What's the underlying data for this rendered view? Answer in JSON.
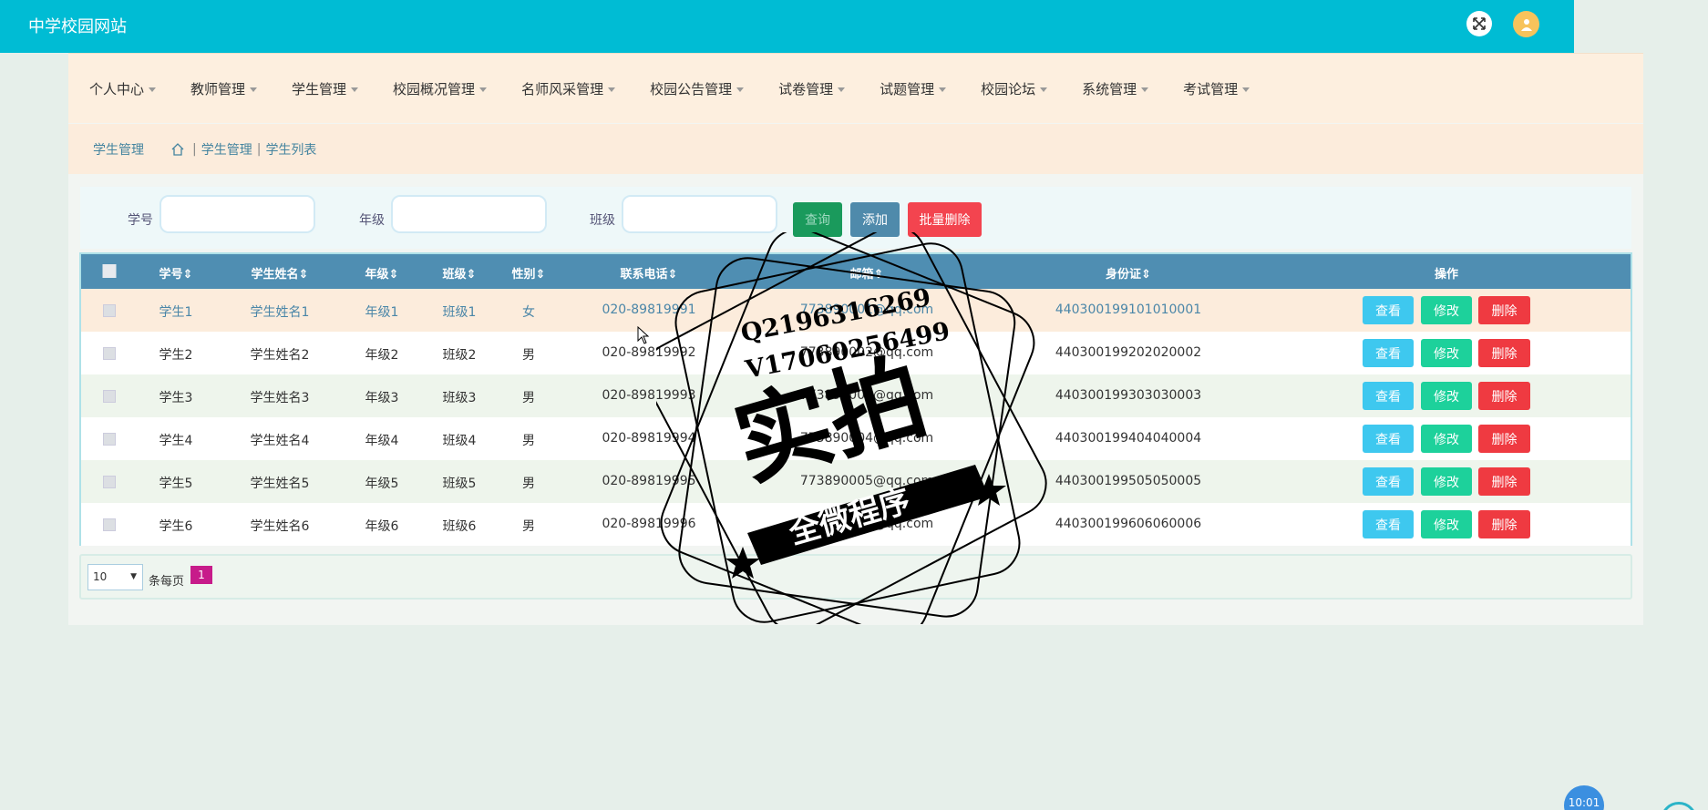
{
  "header": {
    "site_title": "中学校园网站"
  },
  "nav": {
    "items": [
      "个人中心",
      "教师管理",
      "学生管理",
      "校园概况管理",
      "名师风采管理",
      "校园公告管理",
      "试卷管理",
      "试题管理",
      "校园论坛",
      "系统管理",
      "考试管理"
    ]
  },
  "breadcrumb": {
    "title": "学生管理",
    "path1": "学生管理",
    "path2": "学生列表",
    "separator": "|"
  },
  "search": {
    "student_no_label": "学号",
    "grade_label": "年级",
    "class_label": "班级",
    "search_btn": "查询",
    "add_btn": "添加",
    "batch_delete_btn": "批量删除"
  },
  "table": {
    "headers": {
      "student_no": "学号",
      "name": "学生姓名",
      "grade": "年级",
      "class": "班级",
      "gender": "性别",
      "phone": "联系电话",
      "email": "邮箱",
      "id_card": "身份证",
      "ops": "操作"
    },
    "rows": [
      {
        "student_no": "学生1",
        "name": "学生姓名1",
        "grade": "年级1",
        "class": "班级1",
        "gender": "女",
        "phone": "020-89819991",
        "email": "773890001@qq.com",
        "id_card": "440300199101010001"
      },
      {
        "student_no": "学生2",
        "name": "学生姓名2",
        "grade": "年级2",
        "class": "班级2",
        "gender": "男",
        "phone": "020-89819992",
        "email": "773890002@qq.com",
        "id_card": "440300199202020002"
      },
      {
        "student_no": "学生3",
        "name": "学生姓名3",
        "grade": "年级3",
        "class": "班级3",
        "gender": "男",
        "phone": "020-89819993",
        "email": "773890003@qq.com",
        "id_card": "440300199303030003"
      },
      {
        "student_no": "学生4",
        "name": "学生姓名4",
        "grade": "年级4",
        "class": "班级4",
        "gender": "男",
        "phone": "020-89819994",
        "email": "773890004@qq.com",
        "id_card": "440300199404040004"
      },
      {
        "student_no": "学生5",
        "name": "学生姓名5",
        "grade": "年级5",
        "class": "班级5",
        "gender": "男",
        "phone": "020-89819995",
        "email": "773890005@qq.com",
        "id_card": "440300199505050005"
      },
      {
        "student_no": "学生6",
        "name": "学生姓名6",
        "grade": "年级6",
        "class": "班级6",
        "gender": "男",
        "phone": "020-89819996",
        "email": "773890006@qq.com",
        "id_card": "440300199606060006"
      }
    ],
    "actions": {
      "view": "查看",
      "edit": "修改",
      "delete": "删除"
    }
  },
  "pager": {
    "page_size": "10",
    "per_page_label": "条每页",
    "current_page": "1"
  },
  "clock": {
    "time": "10:01"
  },
  "stamp": {
    "line1": "Q2196316269",
    "line2": "V17060256499",
    "big": "实拍",
    "banner": "全微程序"
  },
  "colors": {
    "topbar": "#00bcd4",
    "navbar": "#fdefdf",
    "table_header": "#4f8eb2",
    "view": "#3ec8ef",
    "edit": "#1dd19b",
    "delete": "#ef3a41"
  }
}
